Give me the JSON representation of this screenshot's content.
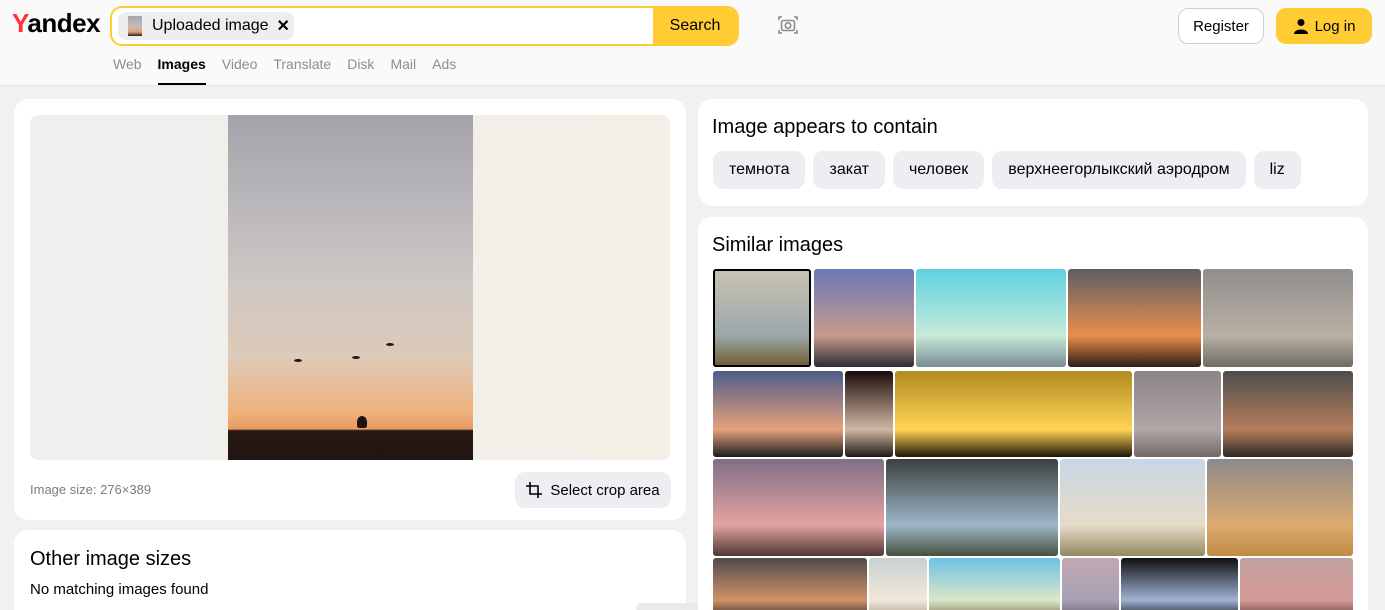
{
  "header": {
    "logo_first": "Y",
    "logo_rest": "andex",
    "search": {
      "uploaded_chip_label": "Uploaded image",
      "close_symbol": "✕",
      "button_label": "Search"
    },
    "camera_icon": "camera-icon",
    "register_label": "Register",
    "login_label": "Log in",
    "tabs": [
      "Web",
      "Images",
      "Video",
      "Translate",
      "Disk",
      "Mail",
      "Ads"
    ],
    "active_tab": "Images"
  },
  "preview": {
    "image_size_text": "Image size: 276×389",
    "crop_button_label": "Select crop area"
  },
  "other_sizes": {
    "title": "Other image sizes",
    "message": "No matching images found"
  },
  "contains": {
    "title": "Image appears to contain",
    "tags": [
      "темнота",
      "закат",
      "человек",
      "верхнеегорлыкский аэродром",
      "liz"
    ]
  },
  "similar": {
    "title": "Similar images",
    "thumb_palettes": [
      [
        "#c9c3b4",
        "#9aa7a8",
        "#6e5a2e"
      ],
      [
        "#6a78b6",
        "#c79a8d",
        "#2c2a33"
      ],
      [
        "#5ed1e2",
        "#c7ead9",
        "#7b8b93"
      ],
      [
        "#5f5c68",
        "#e98f4a",
        "#2c1d18"
      ],
      [
        "#8f8e8e",
        "#b9b0a3",
        "#6e6b62"
      ],
      [
        "#4e5b8a",
        "#e7a27d",
        "#1d1c1e"
      ],
      [
        "#1a0c0d",
        "#d0b7a2",
        "#1f1a13"
      ],
      [
        "#b28b22",
        "#ffd455",
        "#1d1508"
      ],
      [
        "#8c8487",
        "#b0a7a6",
        "#716767"
      ],
      [
        "#4d4d4d",
        "#b67d5c",
        "#2d2b28"
      ],
      [
        "#7f6f87",
        "#e4a3a3",
        "#4f3632"
      ],
      [
        "#3b3f3e",
        "#9db8c9",
        "#46503f"
      ],
      [
        "#c8d6e5",
        "#e6dcc8",
        "#93895e"
      ],
      [
        "#8d8a8b",
        "#dcaa71",
        "#c08b43"
      ],
      [
        "#4f4c4c",
        "#d09267",
        "#2f2a27"
      ],
      [
        "#c8d0d2",
        "#f2e8da",
        "#aa9c86"
      ],
      [
        "#6ec1e5",
        "#dbe7c8",
        "#7b7050"
      ],
      [
        "#c0a8b0",
        "#a8a0b2",
        "#6a626e"
      ],
      [
        "#101010",
        "#9fb3d4",
        "#0d0d0d"
      ],
      [
        "#c1a09e",
        "#d49a97",
        "#5a3b36"
      ]
    ]
  }
}
